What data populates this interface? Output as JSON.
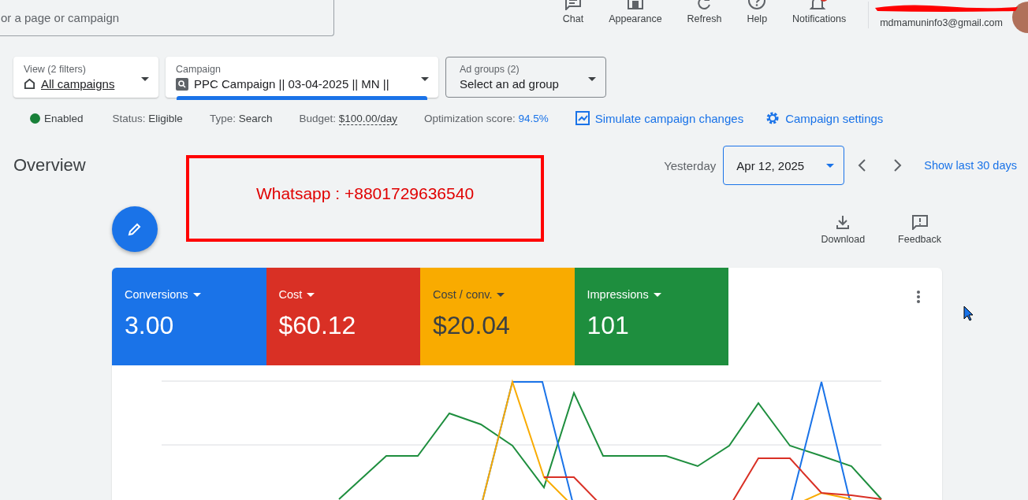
{
  "search": {
    "placeholder": "or a page or campaign"
  },
  "toolbar": [
    {
      "kind": "chat",
      "label": "Chat"
    },
    {
      "kind": "appearance",
      "label": "Appearance"
    },
    {
      "kind": "refresh",
      "label": "Refresh"
    },
    {
      "kind": "help",
      "label": "Help"
    },
    {
      "kind": "notifications",
      "label": "Notifications"
    }
  ],
  "account": {
    "email": "mdmamuninfo3@gmail.com"
  },
  "filters": [
    {
      "kind": "view",
      "label": "View (2 filters)",
      "value": "All campaigns"
    },
    {
      "kind": "campaign",
      "label": "Campaign",
      "value": "PPC Campaign || 03-04-2025 || MN ||"
    },
    {
      "kind": "adgroups",
      "label": "Ad groups (2)",
      "value": "Select an ad group"
    }
  ],
  "status_bar": {
    "state": "Enabled",
    "items": [
      {
        "kind": "plain",
        "label": "Status:",
        "value": "Eligible"
      },
      {
        "kind": "plain",
        "label": "Type:",
        "value": "Search"
      },
      {
        "kind": "budget",
        "label": "Budget:",
        "value": "$100.00/day"
      },
      {
        "kind": "score",
        "label": "Optimization score:",
        "value": "94.5%"
      }
    ],
    "links": [
      {
        "kind": "simulate",
        "label": "Simulate campaign changes"
      },
      {
        "kind": "settings",
        "label": "Campaign settings"
      }
    ]
  },
  "overview": {
    "title": "Overview",
    "date_label": "Yesterday",
    "date": "Apr 12, 2025",
    "show_last": "Show last 30 days",
    "actions": [
      {
        "kind": "download",
        "label": "Download"
      },
      {
        "kind": "feedback",
        "label": "Feedback"
      }
    ]
  },
  "annotation": {
    "text": "Whatsapp : +8801729636540"
  },
  "metrics": [
    {
      "label": "Conversions",
      "value": "3.00",
      "color": "#1a73e8"
    },
    {
      "label": "Cost",
      "value": "$60.12",
      "color": "#d93025"
    },
    {
      "label": "Cost / conv.",
      "value": "$20.04",
      "color": "#f9ab00"
    },
    {
      "label": "Impressions",
      "value": "101",
      "color": "#1e8e3e"
    }
  ]
}
